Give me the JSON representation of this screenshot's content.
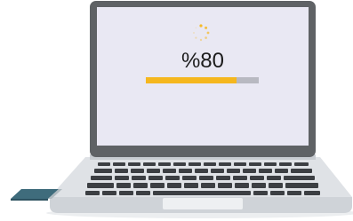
{
  "progress": {
    "label": "%80",
    "value": 0.8
  },
  "colors": {
    "accent": "#f5b71e",
    "track": "#b8b9c1",
    "screen": "#e9e8f3",
    "bezel": "#5f6265"
  },
  "icons": [
    "loading-spinner-icon",
    "usb-drive-icon",
    "laptop-icon"
  ]
}
